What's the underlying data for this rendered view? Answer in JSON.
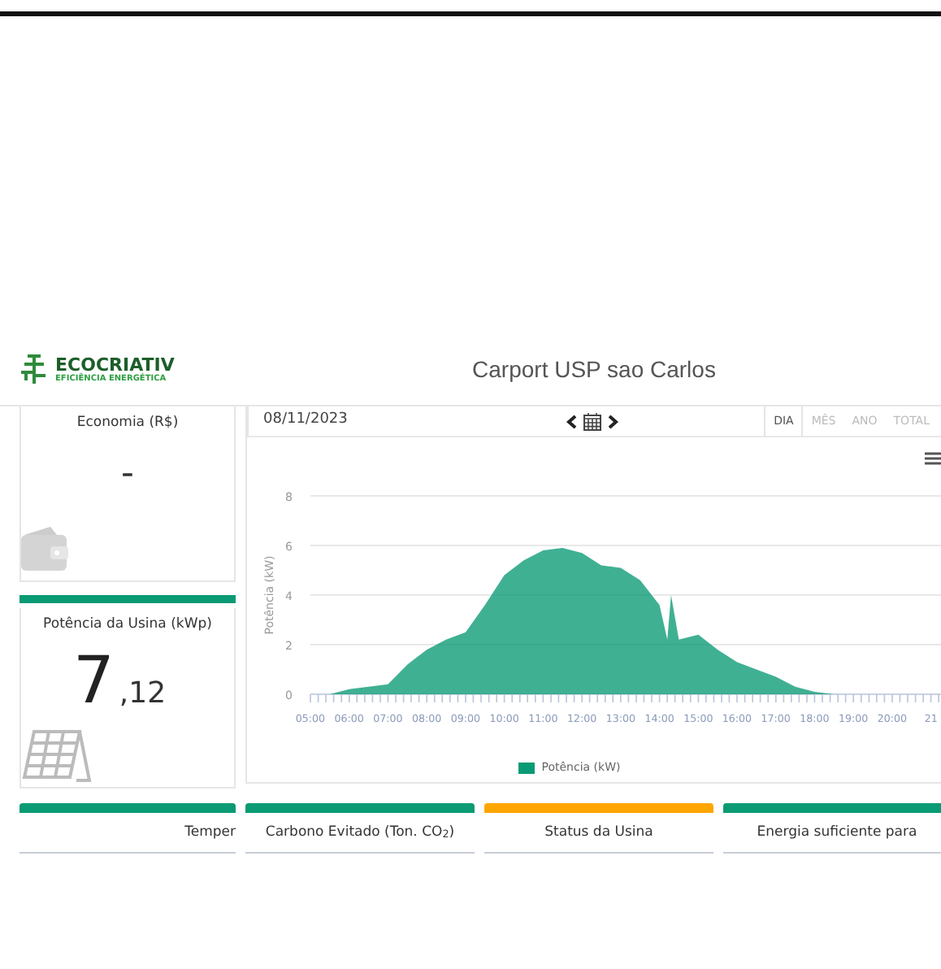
{
  "header": {
    "logo": {
      "name": "ECOCRIATIV",
      "tagline": "EFICIÊNCIA ENERGÉTICA"
    },
    "title": "Carport USP sao Carlos"
  },
  "economy_card": {
    "title": "Economia (R$)",
    "value": "-"
  },
  "power_card": {
    "title": "Potência da Usina (kWp)",
    "value_int": "7",
    "value_dec": ",12",
    "color": "#0a9a74"
  },
  "chart_panel": {
    "date": "08/11/2023",
    "tabs": [
      {
        "label": "DIA",
        "selected": true
      },
      {
        "label": "MÊS",
        "selected": false
      },
      {
        "label": "ANO",
        "selected": false
      },
      {
        "label": "TOTAL",
        "selected": false
      }
    ],
    "chart_data": {
      "type": "area",
      "ylabel": "Potência (kW)",
      "x": [
        5,
        5.5,
        6,
        6.5,
        7,
        7.5,
        8,
        8.5,
        9,
        9.5,
        10,
        10.5,
        11,
        11.5,
        12,
        12.5,
        13,
        13.5,
        14,
        14.2,
        14.3,
        14.5,
        15,
        15.5,
        16,
        16.5,
        17,
        17.5,
        18,
        18.5,
        19,
        19.5,
        20,
        20.5,
        21
      ],
      "series": [
        {
          "name": "Potência (kW)",
          "color": "#0a9a74",
          "values": [
            0,
            0,
            0.2,
            0.3,
            0.4,
            1.2,
            1.8,
            2.2,
            2.5,
            3.6,
            4.8,
            5.4,
            5.8,
            5.9,
            5.7,
            5.2,
            5.1,
            4.6,
            3.6,
            2.2,
            4.0,
            2.2,
            2.4,
            1.8,
            1.3,
            1.0,
            0.7,
            0.3,
            0.1,
            0,
            0,
            0,
            0,
            0,
            0
          ]
        }
      ],
      "xlim": [
        5,
        21.3
      ],
      "ylim": [
        0,
        8
      ],
      "grid": true,
      "yticks": [
        0,
        2,
        4,
        6,
        8
      ],
      "xticks": [
        {
          "value": 5,
          "label": "05:00"
        },
        {
          "value": 6,
          "label": "06:00"
        },
        {
          "value": 7,
          "label": "07:00"
        },
        {
          "value": 8,
          "label": "08:00"
        },
        {
          "value": 9,
          "label": "09:00"
        },
        {
          "value": 10,
          "label": "10:00"
        },
        {
          "value": 11,
          "label": "11:00"
        },
        {
          "value": 12,
          "label": "12:00"
        },
        {
          "value": 13,
          "label": "13:00"
        },
        {
          "value": 14,
          "label": "14:00"
        },
        {
          "value": 15,
          "label": "15:00"
        },
        {
          "value": 16,
          "label": "16:00"
        },
        {
          "value": 17,
          "label": "17:00"
        },
        {
          "value": 18,
          "label": "18:00"
        },
        {
          "value": 19,
          "label": "19:00"
        },
        {
          "value": 20,
          "label": "20:00"
        },
        {
          "value": 21,
          "label": "21"
        }
      ]
    }
  },
  "bottom_cards": [
    {
      "title": "Temper",
      "color": "#0a9a74"
    },
    {
      "title": "Carbono Evitado (Ton. CO$_{2}$)",
      "color": "#0a9a74"
    },
    {
      "title": "Status da Usina",
      "color": "#ffa500"
    },
    {
      "title": "Energia suficiente para",
      "color": "#0a9a74"
    }
  ]
}
